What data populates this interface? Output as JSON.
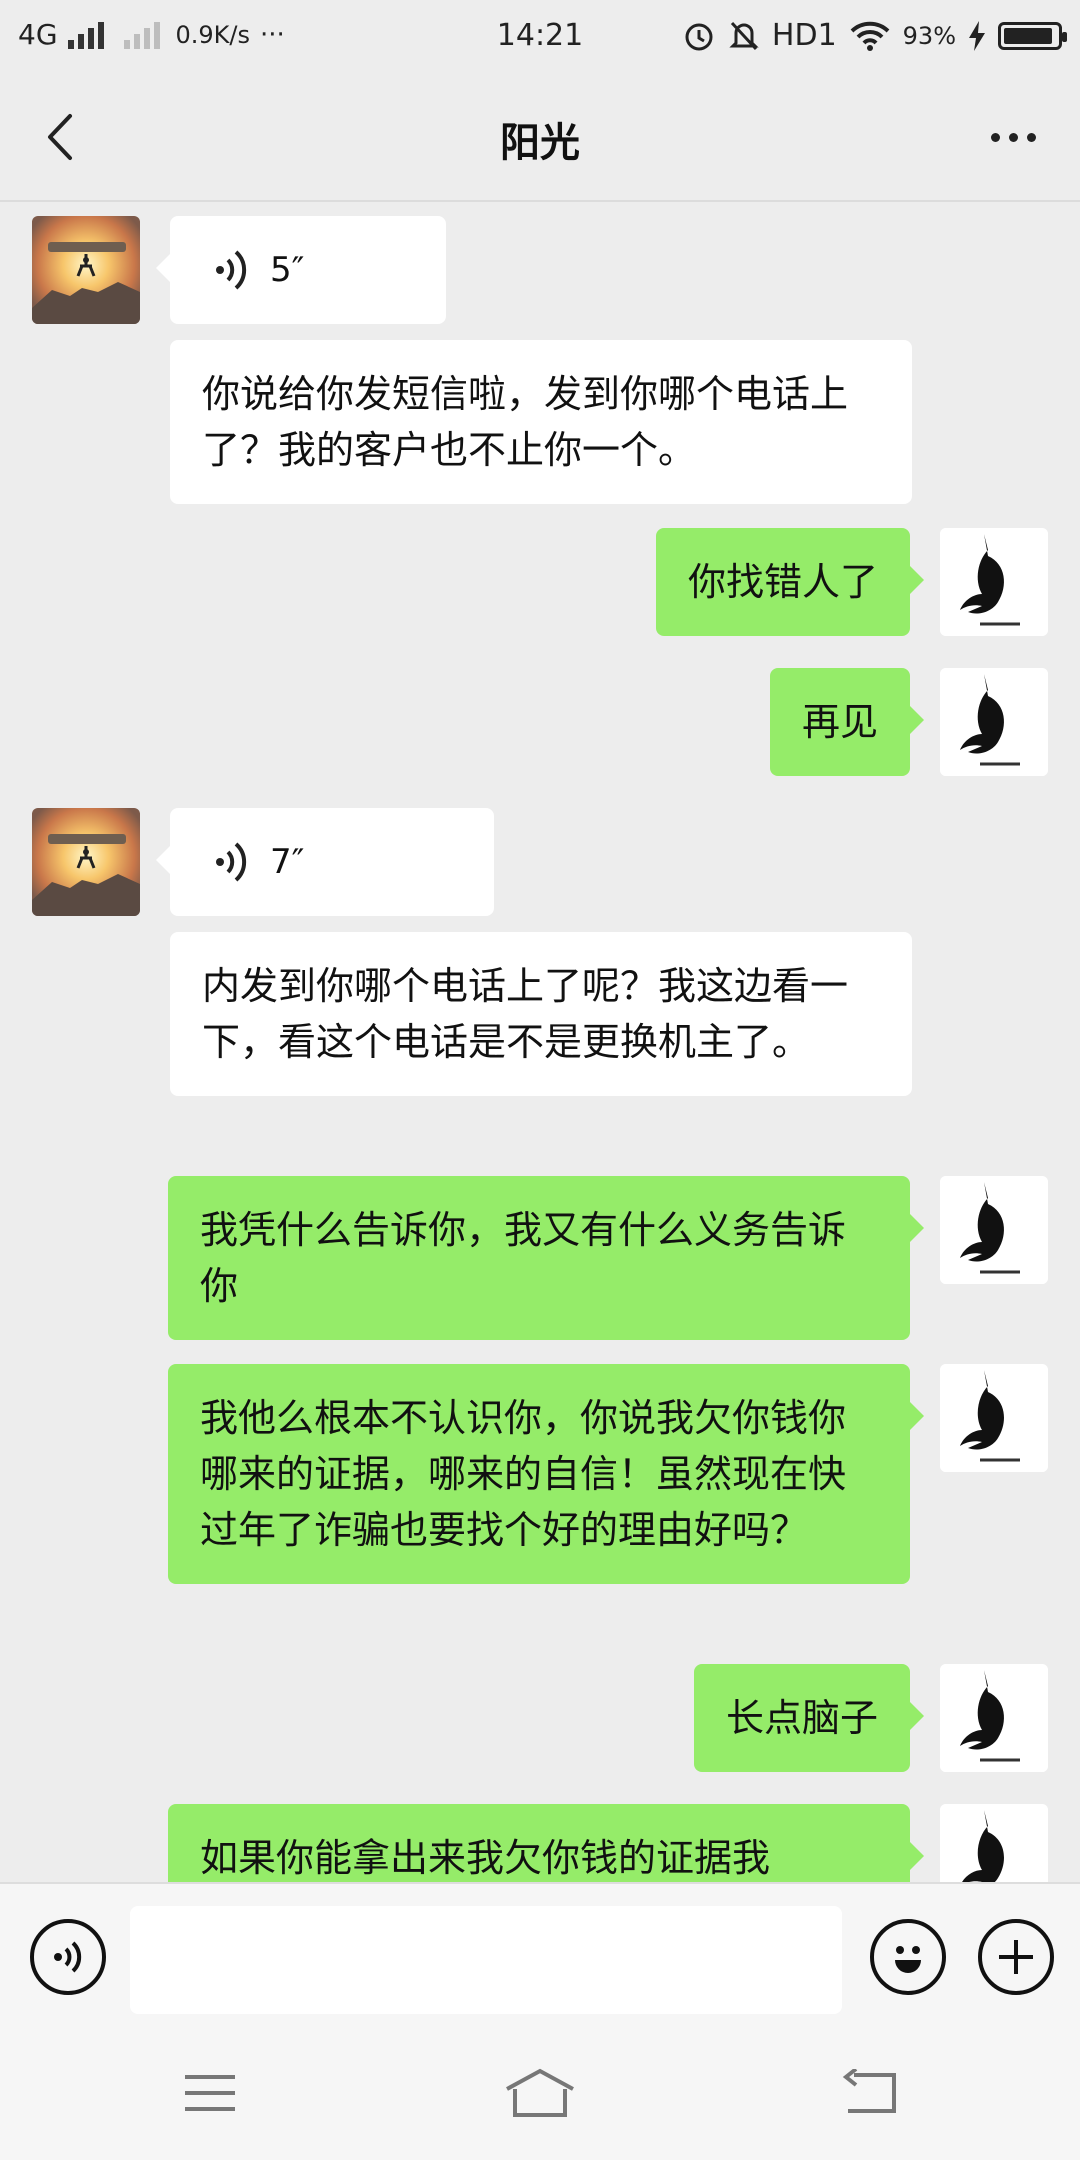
{
  "status_bar": {
    "network": "4G",
    "speed": "0.9K/s",
    "more": "···",
    "time": "14:21",
    "hd": "HD1",
    "battery": "93%",
    "battery_level": 0.93
  },
  "header": {
    "title": "阳光"
  },
  "messages": [
    {
      "side": "in",
      "type": "voice",
      "duration": "5″"
    },
    {
      "side": "in",
      "type": "text",
      "text": "你说给你发短信啦，发到你哪个电话上了？我的客户也不止你一个。"
    },
    {
      "side": "out",
      "type": "text",
      "text": "你找错人了"
    },
    {
      "side": "out",
      "type": "text",
      "text": "再见"
    },
    {
      "side": "in",
      "type": "voice",
      "duration": "7″"
    },
    {
      "side": "in",
      "type": "text",
      "text": "内发到你哪个电话上了呢？我这边看一下，看这个电话是不是更换机主了。"
    },
    {
      "side": "out",
      "type": "text",
      "text": "我凭什么告诉你，我又有什么义务告诉你"
    },
    {
      "side": "out",
      "type": "text",
      "text": "我他么根本不认识你，你说我欠你钱你哪来的证据，哪来的自信！虽然现在快过年了诈骗也要找个好的理由好吗？"
    },
    {
      "side": "out",
      "type": "text",
      "text": "长点脑子"
    },
    {
      "side": "out",
      "type": "text",
      "text": "如果你能拿出来我欠你钱的证据我"
    }
  ],
  "input": {
    "value": "",
    "placeholder": ""
  },
  "icons": {
    "back": "chevron-left-icon",
    "more": "more-dots-icon",
    "voice": "voice-icon",
    "emoji": "emoji-icon",
    "add": "plus-icon",
    "menu": "menu-icon",
    "home": "home-icon",
    "return": "return-icon"
  },
  "colors": {
    "background": "#ededed",
    "incoming_bubble": "#ffffff",
    "outgoing_bubble": "#95ec69",
    "text": "#111111"
  }
}
